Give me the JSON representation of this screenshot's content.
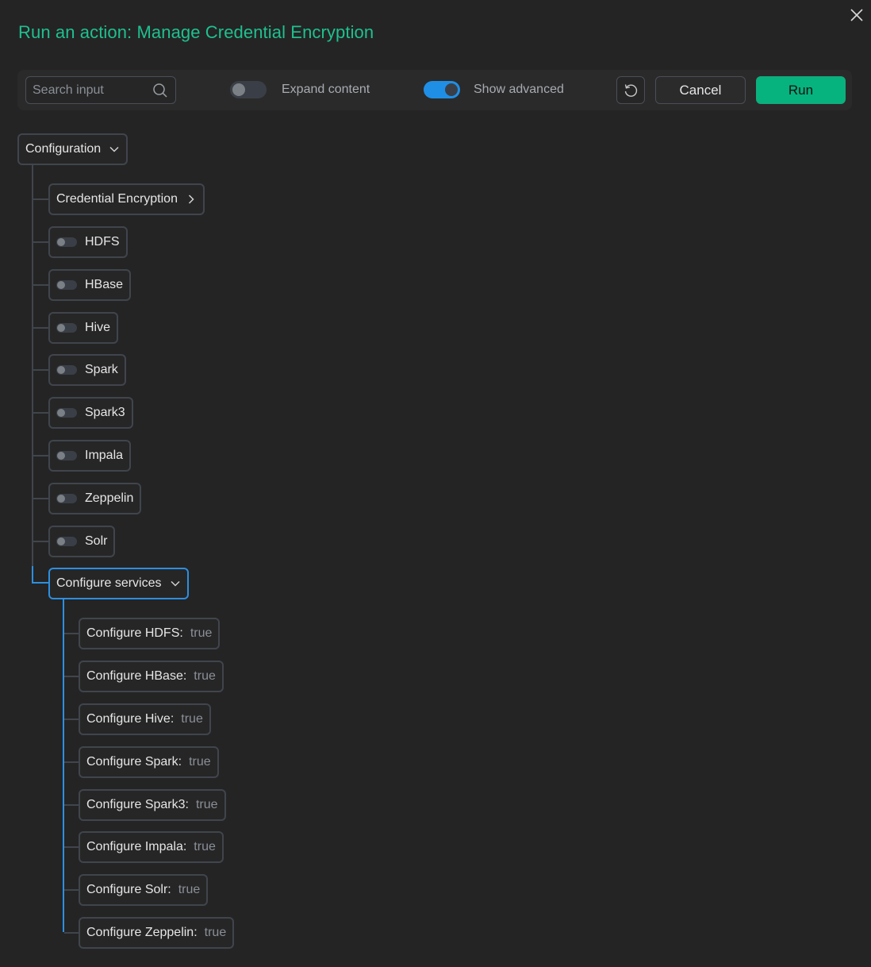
{
  "dialog": {
    "title": "Run an action: Manage Credential Encryption"
  },
  "toolbar": {
    "search_placeholder": "Search input",
    "expand_label": "Expand content",
    "expand_on": false,
    "advanced_label": "Show advanced",
    "advanced_on": true,
    "cancel_label": "Cancel",
    "run_label": "Run"
  },
  "tree": {
    "root_label": "Configuration",
    "credential_label": "Credential Encryption",
    "toggles": [
      {
        "label": "HDFS",
        "on": false
      },
      {
        "label": "HBase",
        "on": false
      },
      {
        "label": "Hive",
        "on": false
      },
      {
        "label": "Spark",
        "on": false
      },
      {
        "label": "Spark3",
        "on": false
      },
      {
        "label": "Impala",
        "on": false
      },
      {
        "label": "Zeppelin",
        "on": false
      },
      {
        "label": "Solr",
        "on": false
      }
    ],
    "services_label": "Configure services",
    "services": [
      {
        "label": "Configure HDFS:",
        "value": "true"
      },
      {
        "label": "Configure HBase:",
        "value": "true"
      },
      {
        "label": "Configure Hive:",
        "value": "true"
      },
      {
        "label": "Configure Spark:",
        "value": "true"
      },
      {
        "label": "Configure Spark3:",
        "value": "true"
      },
      {
        "label": "Configure Impala:",
        "value": "true"
      },
      {
        "label": "Configure Solr:",
        "value": "true"
      },
      {
        "label": "Configure Zeppelin:",
        "value": "true"
      }
    ]
  },
  "colors": {
    "accent_title": "#1fc08f",
    "run_button": "#06b37e",
    "toggle_on": "#1f8fe6",
    "active_border": "#2d8fe0"
  }
}
